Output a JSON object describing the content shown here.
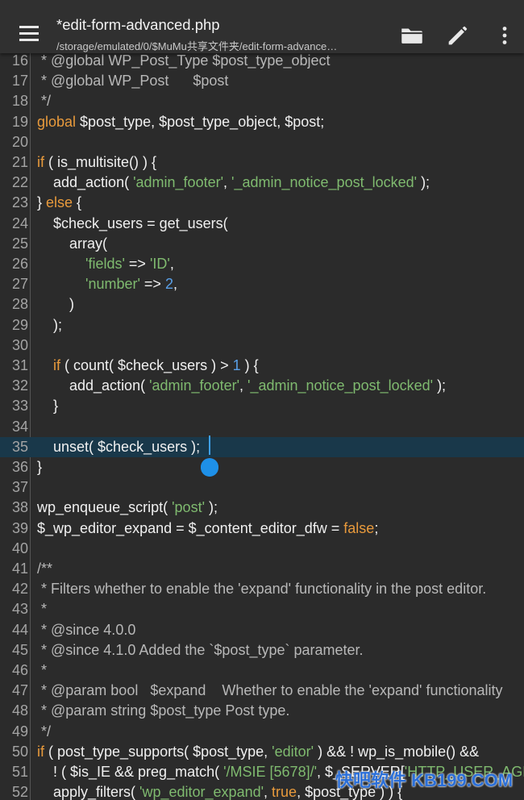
{
  "appbar": {
    "title": "*edit-form-advanced.php",
    "path": "/storage/emulated/0/$MuMu共享文件夹/edit-form-advance…",
    "icons": [
      "menu-icon",
      "folder-icon",
      "pencil-icon",
      "more-vert-icon"
    ]
  },
  "colors": {
    "background": "#2b2b2b",
    "appbar": "#303030",
    "keyword": "#e89a3c",
    "string": "#7fba6f",
    "number": "#5aa0e8",
    "comment": "#b8b8b8",
    "current_line": "#19384a",
    "cursor": "#3f9fe8"
  },
  "editor": {
    "current_line": 35,
    "lines": [
      {
        "n": "16",
        "tokens": [
          {
            "t": " * @global WP_Post_Type $post_type_object",
            "c": "cm"
          }
        ]
      },
      {
        "n": "17",
        "tokens": [
          {
            "t": " * @global WP_Post      $post",
            "c": "cm"
          }
        ]
      },
      {
        "n": "18",
        "tokens": [
          {
            "t": " */",
            "c": "cm"
          }
        ]
      },
      {
        "n": "19",
        "tokens": [
          {
            "t": "global",
            "c": "kw"
          },
          {
            "t": " $post_type, $post_type_object, $post;"
          }
        ]
      },
      {
        "n": "20",
        "tokens": []
      },
      {
        "n": "21",
        "tokens": [
          {
            "t": "if",
            "c": "kw"
          },
          {
            "t": " ( is_multisite() ) {"
          }
        ]
      },
      {
        "n": "22",
        "tokens": [
          {
            "t": "    add_action( "
          },
          {
            "t": "'admin_footer'",
            "c": "str"
          },
          {
            "t": ", "
          },
          {
            "t": "'_admin_notice_post_locked'",
            "c": "str"
          },
          {
            "t": " );"
          }
        ]
      },
      {
        "n": "23",
        "tokens": [
          {
            "t": "} "
          },
          {
            "t": "else",
            "c": "kw"
          },
          {
            "t": " {"
          }
        ]
      },
      {
        "n": "24",
        "tokens": [
          {
            "t": "    $check_users = get_users("
          }
        ]
      },
      {
        "n": "25",
        "tokens": [
          {
            "t": "        array("
          }
        ]
      },
      {
        "n": "26",
        "tokens": [
          {
            "t": "            "
          },
          {
            "t": "'fields'",
            "c": "str"
          },
          {
            "t": " => "
          },
          {
            "t": "'ID'",
            "c": "str"
          },
          {
            "t": ","
          }
        ]
      },
      {
        "n": "27",
        "tokens": [
          {
            "t": "            "
          },
          {
            "t": "'number'",
            "c": "str"
          },
          {
            "t": " => "
          },
          {
            "t": "2",
            "c": "num"
          },
          {
            "t": ","
          }
        ]
      },
      {
        "n": "28",
        "tokens": [
          {
            "t": "        )"
          }
        ]
      },
      {
        "n": "29",
        "tokens": [
          {
            "t": "    );"
          }
        ]
      },
      {
        "n": "30",
        "tokens": []
      },
      {
        "n": "31",
        "tokens": [
          {
            "t": "    "
          },
          {
            "t": "if",
            "c": "kw"
          },
          {
            "t": " ( count( $check_users ) > "
          },
          {
            "t": "1",
            "c": "num"
          },
          {
            "t": " ) {"
          }
        ]
      },
      {
        "n": "32",
        "tokens": [
          {
            "t": "        add_action( "
          },
          {
            "t": "'admin_footer'",
            "c": "str"
          },
          {
            "t": ", "
          },
          {
            "t": "'_admin_notice_post_locked'",
            "c": "str"
          },
          {
            "t": " );"
          }
        ]
      },
      {
        "n": "33",
        "tokens": [
          {
            "t": "    }"
          }
        ]
      },
      {
        "n": "34",
        "tokens": []
      },
      {
        "n": "35",
        "tokens": [
          {
            "t": "    unset( $check_users );"
          }
        ]
      },
      {
        "n": "36",
        "tokens": [
          {
            "t": "}"
          }
        ]
      },
      {
        "n": "37",
        "tokens": []
      },
      {
        "n": "38",
        "tokens": [
          {
            "t": "wp_enqueue_script( "
          },
          {
            "t": "'post'",
            "c": "str"
          },
          {
            "t": " );"
          }
        ]
      },
      {
        "n": "39",
        "tokens": [
          {
            "t": "$_wp_editor_expand = $_content_editor_dfw = "
          },
          {
            "t": "false",
            "c": "kw"
          },
          {
            "t": ";"
          }
        ]
      },
      {
        "n": "40",
        "tokens": []
      },
      {
        "n": "41",
        "tokens": [
          {
            "t": "/**",
            "c": "cm"
          }
        ]
      },
      {
        "n": "42",
        "tokens": [
          {
            "t": " * Filters whether to enable the 'expand' functionality in the post editor.",
            "c": "cm"
          }
        ]
      },
      {
        "n": "43",
        "tokens": [
          {
            "t": " *",
            "c": "cm"
          }
        ]
      },
      {
        "n": "44",
        "tokens": [
          {
            "t": " * @since 4.0.0",
            "c": "cm"
          }
        ]
      },
      {
        "n": "45",
        "tokens": [
          {
            "t": " * @since 4.1.0 Added the `$post_type` parameter.",
            "c": "cm"
          }
        ]
      },
      {
        "n": "46",
        "tokens": [
          {
            "t": " *",
            "c": "cm"
          }
        ]
      },
      {
        "n": "47",
        "tokens": [
          {
            "t": " * @param bool   $expand    Whether to enable the 'expand' functionality",
            "c": "cm"
          }
        ]
      },
      {
        "n": "48",
        "tokens": [
          {
            "t": " * @param string $post_type Post type.",
            "c": "cm"
          }
        ]
      },
      {
        "n": "49",
        "tokens": [
          {
            "t": " */",
            "c": "cm"
          }
        ]
      },
      {
        "n": "50",
        "tokens": [
          {
            "t": "if",
            "c": "kw"
          },
          {
            "t": " ( post_type_supports( $post_type, "
          },
          {
            "t": "'editor'",
            "c": "str"
          },
          {
            "t": " ) && ! wp_is_mobile() &&"
          }
        ]
      },
      {
        "n": "51",
        "tokens": [
          {
            "t": "    ! ( $is_IE && preg_match( "
          },
          {
            "t": "'/MSIE [5678]/'",
            "c": "str"
          },
          {
            "t": ", $_SERVER["
          },
          {
            "t": "'HTTP_USER_AGENT'",
            "c": "str"
          }
        ]
      },
      {
        "n": "52",
        "tokens": [
          {
            "t": "    apply_filters( "
          },
          {
            "t": "'wp_editor_expand'",
            "c": "str"
          },
          {
            "t": ", "
          },
          {
            "t": "true",
            "c": "kw"
          },
          {
            "t": ", $post_type ) ) {"
          }
        ]
      }
    ]
  },
  "watermark": {
    "text": "快吧软件 KB199.COM"
  }
}
